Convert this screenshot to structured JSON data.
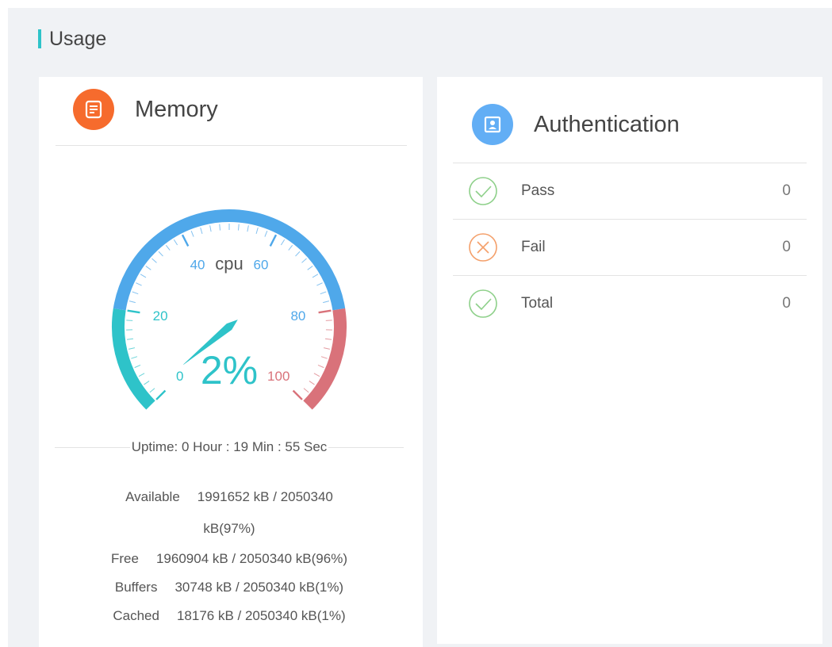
{
  "section": {
    "title": "Usage"
  },
  "memory": {
    "title": "Memory",
    "gauge": {
      "label": "cpu",
      "value": 2,
      "value_text": "2%",
      "min": 0,
      "max": 100,
      "ticks": [
        "0",
        "20",
        "40",
        "60",
        "80",
        "100"
      ],
      "colors": {
        "low": "#2ec3c9",
        "mid": "#4fa8ea",
        "high": "#d9727a"
      }
    },
    "uptime": "Uptime: 0 Hour : 19 Min : 55 Sec",
    "stats": [
      {
        "label": "Available",
        "value": "1991652 kB / 2050340 kB(97%)"
      },
      {
        "label": "Free",
        "value": "1960904 kB / 2050340 kB(96%)"
      },
      {
        "label": "Buffers",
        "value": "30748 kB / 2050340 kB(1%)"
      },
      {
        "label": "Cached",
        "value": "18176 kB / 2050340 kB(1%)"
      }
    ]
  },
  "authentication": {
    "title": "Authentication",
    "rows": [
      {
        "label": "Pass",
        "value": "0",
        "icon": "check-circle-icon"
      },
      {
        "label": "Fail",
        "value": "0",
        "icon": "x-circle-icon"
      },
      {
        "label": "Total",
        "value": "0",
        "icon": "check-circle-icon"
      }
    ]
  }
}
